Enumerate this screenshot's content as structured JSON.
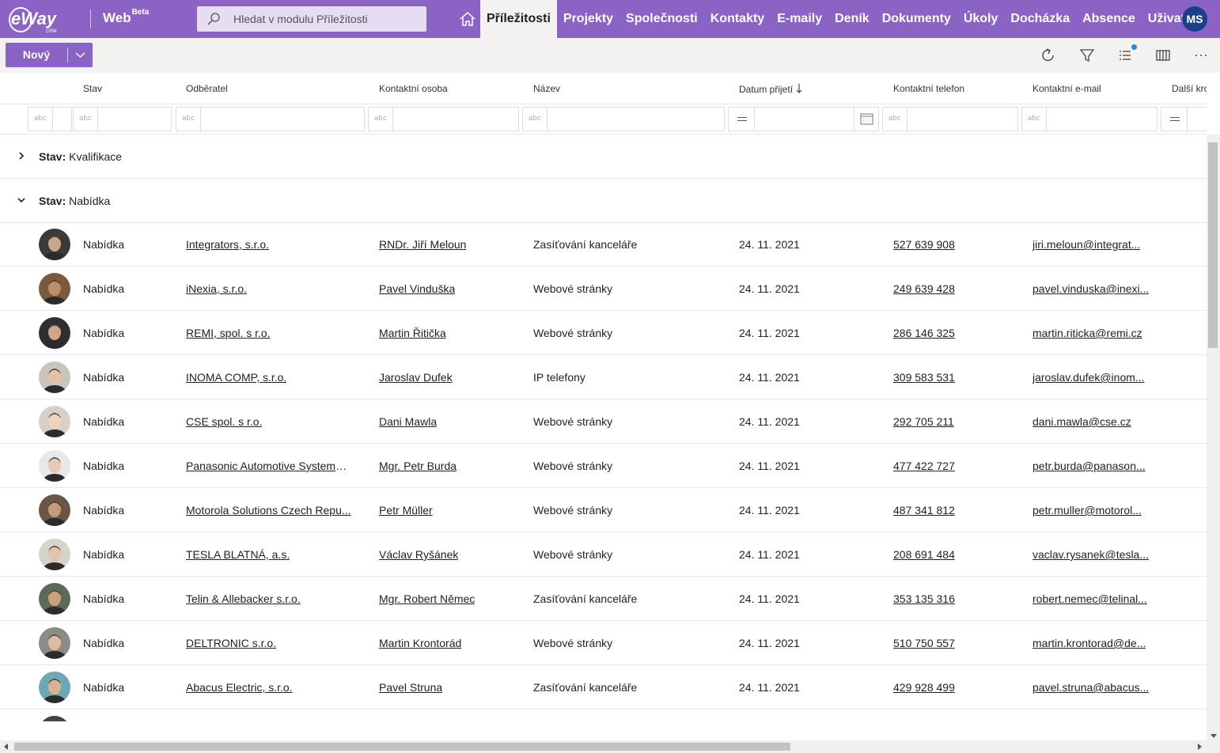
{
  "app": {
    "logo_text": "eWay",
    "logo_sub": "CRM",
    "name": "Web",
    "name_badge": "Beta",
    "user_initials": "MS"
  },
  "search": {
    "placeholder": "Hledat v modulu Příležitosti"
  },
  "nav": [
    {
      "label": "Příležitosti",
      "active": true
    },
    {
      "label": "Projekty"
    },
    {
      "label": "Společnosti"
    },
    {
      "label": "Kontakty"
    },
    {
      "label": "E-maily"
    },
    {
      "label": "Deník"
    },
    {
      "label": "Dokumenty"
    },
    {
      "label": "Úkoly"
    },
    {
      "label": "Docházka"
    },
    {
      "label": "Absence"
    },
    {
      "label": "Uživatelé"
    }
  ],
  "toolbar": {
    "new_label": "Nový",
    "icons": [
      "refresh-icon",
      "filter-icon",
      "list-view-icon",
      "columns-icon",
      "more-icon"
    ]
  },
  "columns": [
    "Stav",
    "Odběratel",
    "Kontaktní osoba",
    "Název",
    "Datum přijetí",
    "Kontaktní telefon",
    "Kontaktní e-mail",
    "Další kro"
  ],
  "filter_placeholder": "abc",
  "groups": [
    {
      "prefix": "Stav:",
      "value": "Kvalifikace",
      "expanded": false
    },
    {
      "prefix": "Stav:",
      "value": "Nabídka",
      "expanded": true
    }
  ],
  "rows": [
    {
      "stav": "Nabídka",
      "odberatel": "Integrators, s.r.o.",
      "osoba": "RNDr. Jiří Meloun",
      "nazev": "Zasíťování kanceláře",
      "datum": "24. 11. 2021",
      "telefon": "527 639 908",
      "email": "jiri.meloun@integrat..."
    },
    {
      "stav": "Nabídka",
      "odberatel": "iNexia, s.r.o.",
      "osoba": "Pavel Vinduška",
      "nazev": "Webové stránky",
      "datum": "24. 11. 2021",
      "telefon": "249 639 428",
      "email": "pavel.vinduska@inexi..."
    },
    {
      "stav": "Nabídka",
      "odberatel": "REMI, spol. s r.o.",
      "osoba": "Martin Řitička",
      "nazev": "Webové stránky",
      "datum": "24. 11. 2021",
      "telefon": "286 146 325",
      "email": "martin.riticka@remi.cz"
    },
    {
      "stav": "Nabídka",
      "odberatel": "INOMA COMP, s.r.o.",
      "osoba": "Jaroslav Dufek",
      "nazev": "IP telefony",
      "datum": "24. 11. 2021",
      "telefon": "309 583 531",
      "email": "jaroslav.dufek@inom..."
    },
    {
      "stav": "Nabídka",
      "odberatel": "CSE spol. s r.o.",
      "osoba": "Dani Mawla",
      "nazev": "Webové stránky",
      "datum": "24. 11. 2021",
      "telefon": "292 705 211",
      "email": "dani.mawla@cse.cz"
    },
    {
      "stav": "Nabídka",
      "odberatel": "Panasonic Automotive Systems ...",
      "osoba": "Mgr. Petr Burda",
      "nazev": "Webové stránky",
      "datum": "24. 11. 2021",
      "telefon": "477 422 727",
      "email": "petr.burda@panason..."
    },
    {
      "stav": "Nabídka",
      "odberatel": "Motorola Solutions Czech Repu...",
      "osoba": "Petr Müller",
      "nazev": "Webové stránky",
      "datum": "24. 11. 2021",
      "telefon": "487 341 812",
      "email": "petr.muller@motorol..."
    },
    {
      "stav": "Nabídka",
      "odberatel": "TESLA BLATNÁ, a.s.",
      "osoba": "Václav Ryšánek",
      "nazev": "Webové stránky",
      "datum": "24. 11. 2021",
      "telefon": "208 691 484",
      "email": "vaclav.rysanek@tesla..."
    },
    {
      "stav": "Nabídka",
      "odberatel": "Telin & Allebacker s.r.o.",
      "osoba": "Mgr. Robert Němec",
      "nazev": "Zasíťování kanceláře",
      "datum": "24. 11. 2021",
      "telefon": "353 135 316",
      "email": "robert.nemec@telinal..."
    },
    {
      "stav": "Nabídka",
      "odberatel": "DELTRONIC s.r.o.",
      "osoba": "Martin Krontorád",
      "nazev": "Webové stránky",
      "datum": "24. 11. 2021",
      "telefon": "510 750 557",
      "email": "martin.krontorad@de..."
    },
    {
      "stav": "Nabídka",
      "odberatel": "Abacus Electric, s.r.o.",
      "osoba": "Pavel Struna",
      "nazev": "Zasíťování kanceláře",
      "datum": "24. 11. 2021",
      "telefon": "429 928 499",
      "email": "pavel.struna@abacus..."
    }
  ],
  "colors": {
    "brand": "#8a63c4",
    "search_bg": "#e6ddf3",
    "avatar_me": "#1b3f8a",
    "badge_dot": "#1e88e5"
  }
}
